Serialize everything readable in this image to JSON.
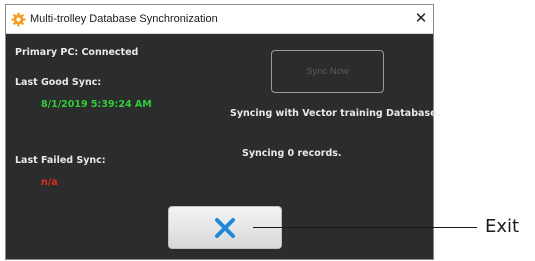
{
  "window": {
    "title": "Multi-trolley Database Synchronization",
    "title_icon": "orange-gear-icon",
    "close_glyph": "✕"
  },
  "status": {
    "primary_pc": "Primary PC: Connected",
    "last_good_sync_label": "Last Good Sync:",
    "last_good_sync_value": "8/1/2019 5:39:24 AM",
    "last_failed_sync_label": "Last Failed Sync:",
    "last_failed_sync_value": "n/a",
    "syncing_message": "Syncing with Vector training Database.",
    "records_message": "Syncing 0 records."
  },
  "buttons": {
    "sync_now_label": "Sync Now",
    "exit_icon": "blue-x-icon"
  },
  "annotation": {
    "exit_label": "Exit"
  },
  "colors": {
    "panel_background": "#2b2d2c",
    "good_value": "#33cc3a",
    "failed_value": "#e02a1c",
    "exit_icon": "#1e88d8",
    "title_icon": "#f0a020"
  }
}
